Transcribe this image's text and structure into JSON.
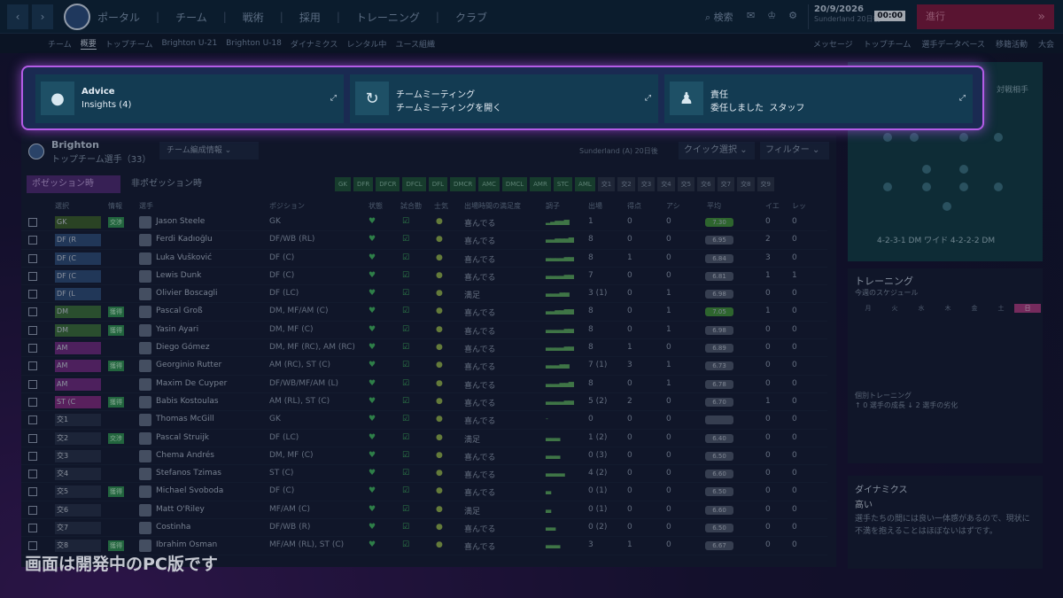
{
  "topbar": {
    "nav": [
      "ポータル",
      "チーム",
      "戦術",
      "採用",
      "トレーニング",
      "クラブ"
    ],
    "search": "検索",
    "date": "20/9/2026",
    "date_sub": "Sunderland 20日後",
    "time": "00:00",
    "continue_label": "進行"
  },
  "subnav": {
    "left": [
      "チーム",
      "概要",
      "トップチーム",
      "Brighton U-21",
      "Brighton U-18",
      "ダイナミクス",
      "レンタル中",
      "ユース組織"
    ],
    "right": [
      "メッセージ",
      "トップチーム",
      "選手データベース",
      "移籍活動",
      "大会"
    ]
  },
  "advice": {
    "card1_title": "Advice",
    "card1_sub": "Insights (4)",
    "card2_title": "チームミーティング",
    "card2_sub": "チームミーティングを開く",
    "card3_title": "責任",
    "card3_sub": "委任しました",
    "card3_extra": "スタッフ"
  },
  "panel": {
    "team_name": "Brighton",
    "team_sub": "トップチーム選手（33）",
    "view_dropdown": "チーム編成情報",
    "next_match": "Sunderland (A) 20日後",
    "quick_select": "クイック選択",
    "filter": "フィルター",
    "tab_pos": "ポゼッション時",
    "tab_npos": "非ポゼッション時",
    "chips": [
      "GK",
      "DFR",
      "DFCR",
      "DFCL",
      "DFL",
      "DMCR",
      "AMC",
      "DMCL",
      "AMR",
      "STC",
      "AML",
      "交1",
      "交2",
      "交3",
      "交4",
      "交5",
      "交6",
      "交7",
      "交8",
      "交9"
    ],
    "columns": [
      "選択",
      "情報",
      "選手",
      "ポジション",
      "状態",
      "試合勘",
      "士気",
      "出場時間の満足度",
      "調子",
      "出場",
      "得点",
      "アシ",
      "平均",
      "イエ",
      "レッ"
    ]
  },
  "players": [
    {
      "slot": "GK",
      "tag": "交渉",
      "name": "Jason Steele",
      "pos": "GK",
      "happy": "喜んでる",
      "form": "▂▃▄▄▅",
      "apps": "1",
      "goals": "0",
      "assists": "0",
      "rating": "7.30",
      "yel": "0",
      "red": "0"
    },
    {
      "slot": "DF (R",
      "tag": "",
      "name": "Ferdi Kadıoğlu",
      "pos": "DF/WB (RL)",
      "happy": "喜んでる",
      "form": "▃▃▄▄▄▅",
      "apps": "8",
      "goals": "0",
      "assists": "0",
      "rating": "6.95",
      "yel": "2",
      "red": "0"
    },
    {
      "slot": "DF (C",
      "tag": "",
      "name": "Luka Vušković",
      "pos": "DF (C)",
      "happy": "喜んでる",
      "form": "▃▃▃▃▄▄",
      "apps": "8",
      "goals": "1",
      "assists": "0",
      "rating": "6.84",
      "yel": "3",
      "red": "0"
    },
    {
      "slot": "DF (C",
      "tag": "",
      "name": "Lewis Dunk",
      "pos": "DF (C)",
      "happy": "喜んでる",
      "form": "▃▃▃▃▄▄",
      "apps": "7",
      "goals": "0",
      "assists": "0",
      "rating": "6.81",
      "yel": "1",
      "red": "1"
    },
    {
      "slot": "DF (L",
      "tag": "",
      "name": "Olivier Boscagli",
      "pos": "DF (LC)",
      "happy": "満足",
      "form": "▃▃▃▄▄",
      "apps": "3 (1)",
      "goals": "0",
      "assists": "1",
      "rating": "6.98",
      "yel": "0",
      "red": "0"
    },
    {
      "slot": "DM",
      "tag": "獲得",
      "name": "Pascal Groß",
      "pos": "DM, MF/AM (C)",
      "happy": "喜んでる",
      "form": "▃▃▄▄▅▅",
      "apps": "8",
      "goals": "0",
      "assists": "1",
      "rating": "7.05",
      "yel": "1",
      "red": "0"
    },
    {
      "slot": "DM",
      "tag": "獲得",
      "name": "Yasin Ayari",
      "pos": "DM, MF (C)",
      "happy": "喜んでる",
      "form": "▃▃▃▃▄▄",
      "apps": "8",
      "goals": "0",
      "assists": "1",
      "rating": "6.98",
      "yel": "0",
      "red": "0"
    },
    {
      "slot": "AM",
      "tag": "",
      "name": "Diego Gómez",
      "pos": "DM, MF (RC), AM (RC)",
      "happy": "喜んでる",
      "form": "▃▃▃▃▄▄",
      "apps": "8",
      "goals": "1",
      "assists": "0",
      "rating": "6.89",
      "yel": "0",
      "red": "0"
    },
    {
      "slot": "AM",
      "tag": "獲得",
      "name": "Georginio Rutter",
      "pos": "AM (RC), ST (C)",
      "happy": "喜んでる",
      "form": "▃▃▃▄▄",
      "apps": "7 (1)",
      "goals": "3",
      "assists": "1",
      "rating": "6.73",
      "yel": "0",
      "red": "0"
    },
    {
      "slot": "AM",
      "tag": "",
      "name": "Maxim De Cuyper",
      "pos": "DF/WB/MF/AM (L)",
      "happy": "喜んでる",
      "form": "▃▃▃▄▄▅",
      "apps": "8",
      "goals": "0",
      "assists": "1",
      "rating": "6.78",
      "yel": "0",
      "red": "0"
    },
    {
      "slot": "ST (C",
      "tag": "獲得",
      "name": "Babis Kostoulas",
      "pos": "AM (RL), ST (C)",
      "happy": "喜んでる",
      "form": "▃▃▃▃▄▄",
      "apps": "5 (2)",
      "goals": "2",
      "assists": "0",
      "rating": "6.70",
      "yel": "1",
      "red": "0"
    },
    {
      "slot": "交1",
      "tag": "",
      "name": "Thomas McGill",
      "pos": "GK",
      "happy": "喜んでる",
      "form": "-",
      "apps": "0",
      "goals": "0",
      "assists": "0",
      "rating": "",
      "yel": "0",
      "red": "0"
    },
    {
      "slot": "交2",
      "tag": "交渉",
      "name": "Pascal Struijk",
      "pos": "DF (LC)",
      "happy": "満足",
      "form": "▃▃▃",
      "apps": "1 (2)",
      "goals": "0",
      "assists": "0",
      "rating": "6.40",
      "yel": "0",
      "red": "0"
    },
    {
      "slot": "交3",
      "tag": "",
      "name": "Chema Andrés",
      "pos": "DM, MF (C)",
      "happy": "喜んでる",
      "form": "▃▃▃",
      "apps": "0 (3)",
      "goals": "0",
      "assists": "0",
      "rating": "6.50",
      "yel": "0",
      "red": "0"
    },
    {
      "slot": "交4",
      "tag": "",
      "name": "Stefanos Tzimas",
      "pos": "ST (C)",
      "happy": "喜んでる",
      "form": "▃▃▃▃",
      "apps": "4 (2)",
      "goals": "0",
      "assists": "0",
      "rating": "6.60",
      "yel": "0",
      "red": "0"
    },
    {
      "slot": "交5",
      "tag": "獲得",
      "name": "Michael Svoboda",
      "pos": "DF (C)",
      "happy": "喜んでる",
      "form": "▃",
      "apps": "0 (1)",
      "goals": "0",
      "assists": "0",
      "rating": "6.50",
      "yel": "0",
      "red": "0"
    },
    {
      "slot": "交6",
      "tag": "",
      "name": "Matt O'Riley",
      "pos": "MF/AM (C)",
      "happy": "満足",
      "form": "▃",
      "apps": "0 (1)",
      "goals": "0",
      "assists": "0",
      "rating": "6.60",
      "yel": "0",
      "red": "0"
    },
    {
      "slot": "交7",
      "tag": "",
      "name": "Costinha",
      "pos": "DF/WB (R)",
      "happy": "喜んでる",
      "form": "▃▃",
      "apps": "0 (2)",
      "goals": "0",
      "assists": "0",
      "rating": "6.50",
      "yel": "0",
      "red": "0"
    },
    {
      "slot": "交8",
      "tag": "獲得",
      "name": "Ibrahim Osman",
      "pos": "MF/AM (RL), ST (C)",
      "happy": "喜んでる",
      "form": "▃▃▃",
      "apps": "3",
      "goals": "1",
      "assists": "0",
      "rating": "6.67",
      "yel": "0",
      "red": "0"
    }
  ],
  "side": {
    "opponent": "対戦相手",
    "formations": "4-2-3-1 DM ワイド  4-2-2-2 DM",
    "training_title": "トレーニング",
    "training_sub": "今週のスケジュール",
    "days": [
      "月",
      "火",
      "水",
      "木",
      "金",
      "土",
      "日"
    ],
    "indiv_title": "個別トレーニング",
    "prog_text": "↑ 0 選手の成長    ↓ 2 選手の劣化",
    "dyn_title": "ダイナミクス",
    "dyn_level": "高い",
    "dyn_desc": "選手たちの間には良い一体感があるので、現状に不満を抱えることはほぼないはずです。"
  },
  "watermark": "画面は開発中のPC版です"
}
